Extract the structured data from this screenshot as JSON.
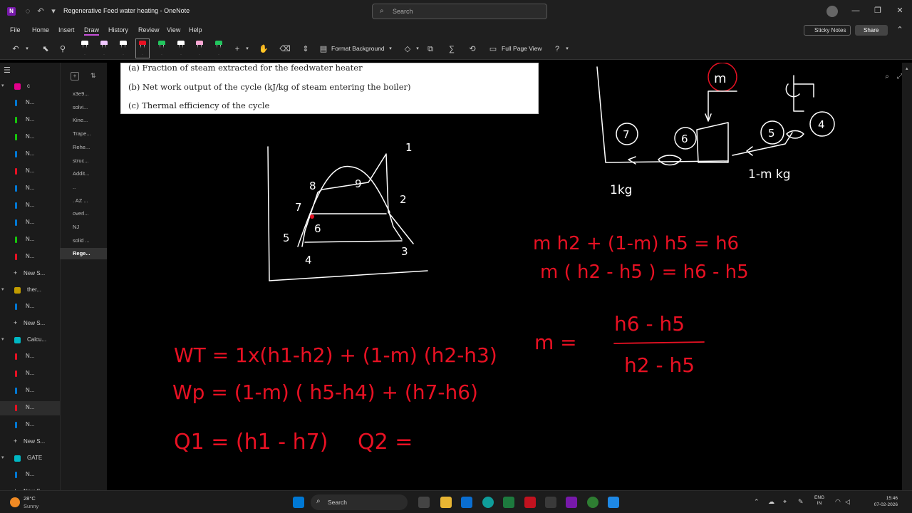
{
  "window": {
    "title": "Regenerative Feed water heating  -  OneNote",
    "search_placeholder": "Search"
  },
  "menu": {
    "items": [
      "File",
      "Home",
      "Insert",
      "Draw",
      "History",
      "Review",
      "View",
      "Help"
    ],
    "active": "Draw",
    "sticky_notes": "Sticky Notes",
    "share": "Share"
  },
  "toolbar": {
    "format_background": "Format Background",
    "full_page_view": "Full Page View",
    "pen_colors": [
      "#ffffff",
      "#f0c8ff",
      "#ffffff",
      "#e81123",
      "#22c55e",
      "#ffffff",
      "#f9a8d4",
      "#22c55e"
    ]
  },
  "sections": [
    {
      "label": "c",
      "color": "#e3008c",
      "type": "group"
    },
    {
      "label": "N...",
      "color": "#0078d4"
    },
    {
      "label": "N...",
      "color": "#16c60c"
    },
    {
      "label": "N...",
      "color": "#16c60c"
    },
    {
      "label": "N...",
      "color": "#0078d4"
    },
    {
      "label": "N...",
      "color": "#e81123"
    },
    {
      "label": "N...",
      "color": "#0078d4"
    },
    {
      "label": "N...",
      "color": "#0078d4"
    },
    {
      "label": "N...",
      "color": "#0078d4"
    },
    {
      "label": "N...",
      "color": "#16c60c"
    },
    {
      "label": "N...",
      "color": "#e81123"
    },
    {
      "label": "New S...",
      "type": "new"
    },
    {
      "label": "ther...",
      "color": "#c19c00",
      "type": "group"
    },
    {
      "label": "N...",
      "color": "#0078d4"
    },
    {
      "label": "New S...",
      "type": "new"
    },
    {
      "label": "Calcu...",
      "color": "#00b7c3",
      "type": "group"
    },
    {
      "label": "N...",
      "color": "#e81123"
    },
    {
      "label": "N...",
      "color": "#e81123"
    },
    {
      "label": "N...",
      "color": "#0078d4"
    },
    {
      "label": "N...",
      "color": "#e81123",
      "selected": true
    },
    {
      "label": "N...",
      "color": "#0078d4"
    },
    {
      "label": "New S...",
      "type": "new"
    },
    {
      "label": "GATE",
      "color": "#00b7c3",
      "type": "group"
    },
    {
      "label": "N...",
      "color": "#0078d4"
    },
    {
      "label": "New S...",
      "type": "new"
    }
  ],
  "pages": [
    "x3e9...",
    "solvi...",
    "Kine...",
    "Trape...",
    "Rehe...",
    "struc...",
    "Addit...",
    "..",
    ". AZ ...",
    "overl...",
    "NJ",
    "solid ...",
    "Rege..."
  ],
  "selected_page": "Rege...",
  "paper": {
    "lines": [
      "(a)  Fraction of steam extracted for the feedwater heater",
      "(b)  Net work output of the cycle (kJ/kg of steam entering the boiler)",
      "(c)  Thermal efficiency of the cycle"
    ]
  },
  "diagram": {
    "ts_labels": [
      "1",
      "2",
      "3",
      "4",
      "5",
      "6",
      "7",
      "8",
      "9"
    ],
    "schematic_labels": [
      "m",
      "7",
      "6",
      "5",
      "4",
      "1kg",
      "1-m  kg"
    ]
  },
  "equations": {
    "eq1": "m h2 + (1-m) h5 = h6",
    "eq2": "m ( h2 - h5 ) = h6 - h5",
    "m_frac_lhs": "m =",
    "m_frac_num": "h6 - h5",
    "m_frac_den": "h2 - h5",
    "wt": "WT = 1x(h1-h2) + (1-m) (h2-h3)",
    "wp": "Wp = (1-m) ( h5-h4) + (h7-h6)",
    "q1": "Q1 = (h1 - h7)",
    "q2": "Q2 ="
  },
  "taskbar": {
    "temp": "28°C",
    "weather": "Sunny",
    "search": "Search",
    "lang_top": "ENG",
    "lang_bottom": "IN",
    "time": "15:46",
    "date": "07-02-2026"
  }
}
